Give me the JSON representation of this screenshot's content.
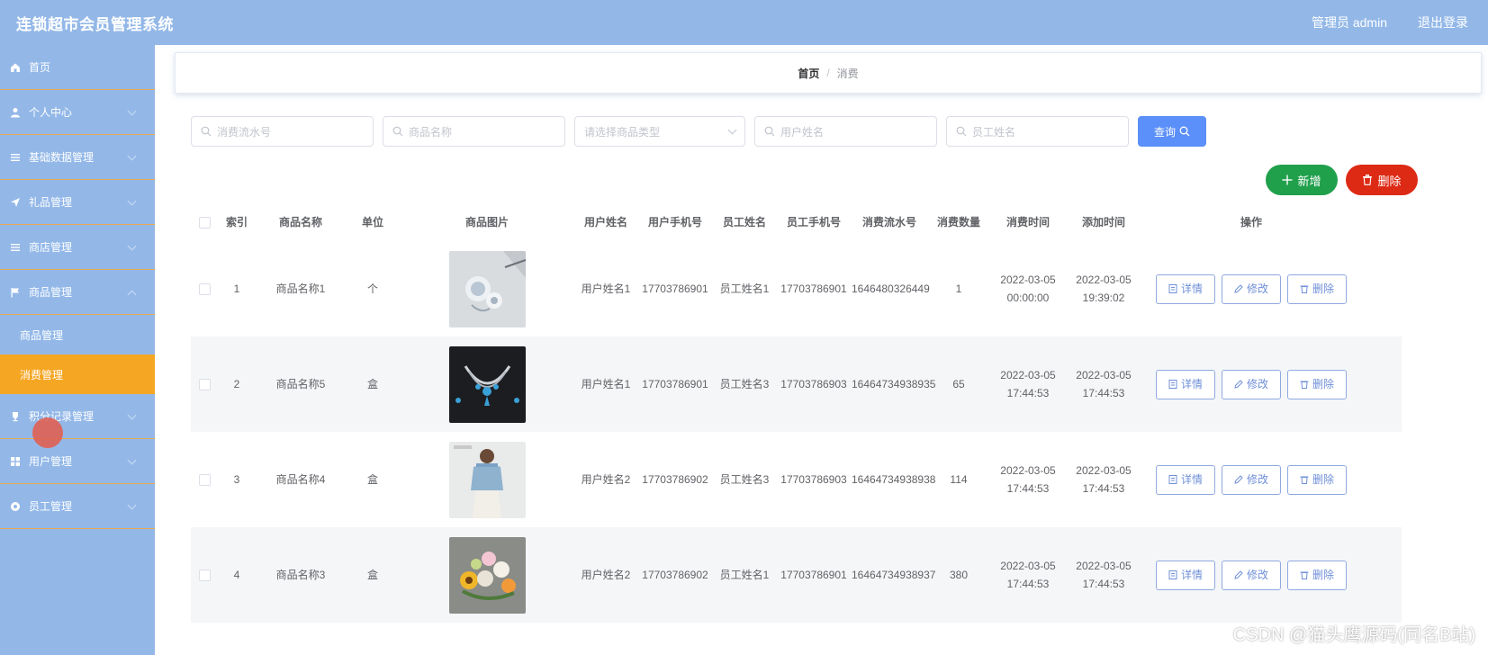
{
  "header": {
    "title": "连锁超市会员管理系统",
    "admin_label": "管理员 admin",
    "logout_label": "退出登录"
  },
  "sidebar": {
    "items": [
      {
        "label": "首页",
        "icon": "home-icon"
      },
      {
        "label": "个人中心",
        "icon": "user-icon"
      },
      {
        "label": "基础数据管理",
        "icon": "list-icon"
      },
      {
        "label": "礼品管理",
        "icon": "send-icon"
      },
      {
        "label": "商店管理",
        "icon": "list-icon"
      },
      {
        "label": "商品管理",
        "icon": "flag-icon"
      }
    ],
    "sub_items": [
      {
        "label": "商品管理"
      },
      {
        "label": "消费管理"
      }
    ],
    "items_after": [
      {
        "label": "积分记录管理",
        "icon": "trophy-icon"
      },
      {
        "label": "用户管理",
        "icon": "grid-icon"
      },
      {
        "label": "员工管理",
        "icon": "circle-icon"
      }
    ],
    "active": "消费管理"
  },
  "breadcrumb": {
    "home": "首页",
    "separator": "/",
    "current": "消费"
  },
  "filters": {
    "serial_placeholder": "消费流水号",
    "product_placeholder": "商品名称",
    "type_placeholder": "请选择商品类型",
    "user_placeholder": "用户姓名",
    "staff_placeholder": "员工姓名",
    "query_label": "查询"
  },
  "actions": {
    "add_label": "新增",
    "delete_label": "删除"
  },
  "table": {
    "headers": {
      "index": "索引",
      "name": "商品名称",
      "unit": "单位",
      "image": "商品图片",
      "user": "用户姓名",
      "user_phone": "用户手机号",
      "staff": "员工姓名",
      "staff_phone": "员工手机号",
      "serial": "消费流水号",
      "qty": "消费数量",
      "consume_time": "消费时间",
      "add_time": "添加时间",
      "ops": "操作"
    },
    "ops_labels": {
      "detail": "详情",
      "edit": "修改",
      "delete": "删除"
    },
    "rows": [
      {
        "index": "1",
        "name": "商品名称1",
        "unit": "个",
        "user": "用户姓名1",
        "user_phone": "17703786901",
        "staff": "员工姓名1",
        "staff_phone": "17703786901",
        "serial": "1646480326449",
        "qty": "1",
        "consume_time": "2022-03-05 00:00:00",
        "add_time": "2022-03-05 19:39:02",
        "image_desc": "crystal-ornament"
      },
      {
        "index": "2",
        "name": "商品名称5",
        "unit": "盒",
        "user": "用户姓名1",
        "user_phone": "17703786901",
        "staff": "员工姓名3",
        "staff_phone": "17703786903",
        "serial": "16464734938935",
        "qty": "65",
        "consume_time": "2022-03-05 17:44:53",
        "add_time": "2022-03-05 17:44:53",
        "image_desc": "necklace"
      },
      {
        "index": "3",
        "name": "商品名称4",
        "unit": "盒",
        "user": "用户姓名2",
        "user_phone": "17703786902",
        "staff": "员工姓名3",
        "staff_phone": "17703786903",
        "serial": "16464734938938",
        "qty": "114",
        "consume_time": "2022-03-05 17:44:53",
        "add_time": "2022-03-05 17:44:53",
        "image_desc": "blue-blouse"
      },
      {
        "index": "4",
        "name": "商品名称3",
        "unit": "盒",
        "user": "用户姓名2",
        "user_phone": "17703786902",
        "staff": "员工姓名1",
        "staff_phone": "17703786901",
        "serial": "16464734938937",
        "qty": "380",
        "consume_time": "2022-03-05 17:44:53",
        "add_time": "2022-03-05 17:44:53",
        "image_desc": "flower-bouquet"
      }
    ]
  },
  "watermark": "CSDN @猫头鹰源码(同名B站)"
}
